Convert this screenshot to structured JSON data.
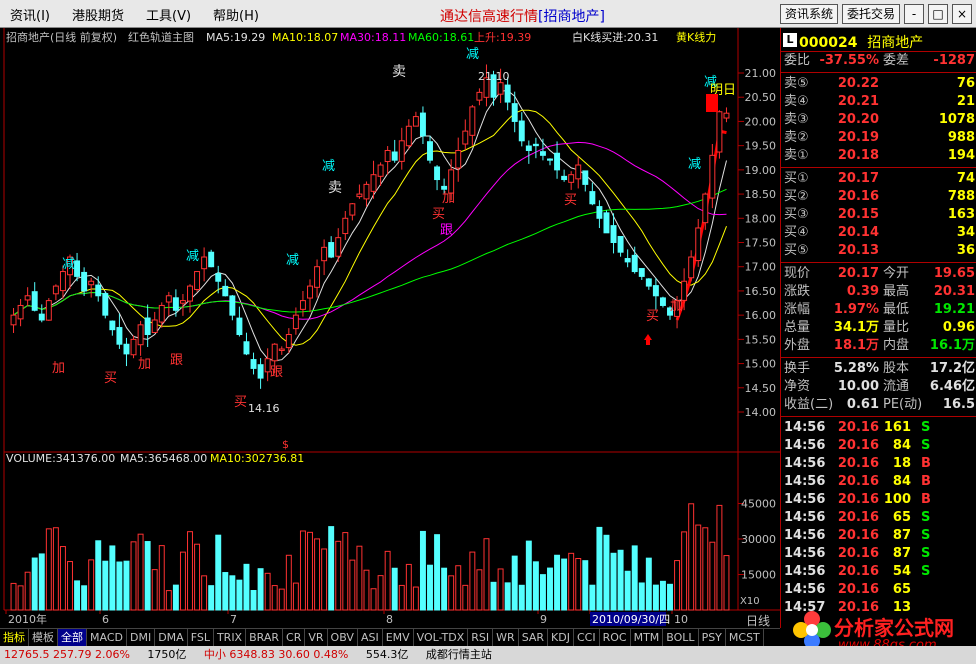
{
  "menu": [
    "资讯(I)",
    "港股期货",
    "工具(V)",
    "帮助(H)"
  ],
  "app_title": "通达信高速行情",
  "app_stock": "[招商地产]",
  "top_buttons": [
    "资讯系统",
    "委托交易"
  ],
  "window_buttons": [
    "-",
    "□",
    "×"
  ],
  "chart_header": {
    "name": "招商地产(日线 前复权)",
    "indicator": "红色轨道主图",
    "ma5": "MA5:19.29",
    "ma10": "MA10:18.07",
    "ma30": "MA30:18.11",
    "ma60": "MA60:18.61",
    "trend": "上升:19.39",
    "bline": "白K线买进:20.31",
    "yline": "黄K线力"
  },
  "volume_header": {
    "vol": "VOLUME:341376.00",
    "ma5": "MA5:365468.00",
    "ma10": "MA10:302736.81"
  },
  "annotations": {
    "sell1": "卖",
    "sell2": "卖",
    "sell3": "卖",
    "reduce": "减",
    "buy": "买",
    "add": "加",
    "follow": "跟",
    "tomorrow": "明日",
    "low_label": "14.16",
    "high_label": "21.10"
  },
  "chart_data": {
    "type": "candlestick",
    "price_axis": [
      21.0,
      20.5,
      20.0,
      19.5,
      19.0,
      18.5,
      18.0,
      17.5,
      17.0,
      16.5,
      16.0,
      15.5,
      15.0,
      14.5,
      14.0
    ],
    "volume_axis": [
      45000,
      30000,
      15000
    ],
    "volume_unit": "X10",
    "x_labels": [
      "2010年",
      "6",
      "7",
      "8",
      "9",
      "2010/09/30/四",
      "10"
    ],
    "closes": [
      16.0,
      16.2,
      16.4,
      16.1,
      15.9,
      16.3,
      16.6,
      16.9,
      17.2,
      16.8,
      16.5,
      16.7,
      16.4,
      16.0,
      15.7,
      15.4,
      15.2,
      15.5,
      15.8,
      15.6,
      15.9,
      16.2,
      16.4,
      16.1,
      16.3,
      16.6,
      16.9,
      17.2,
      17.0,
      16.7,
      16.4,
      16.0,
      15.6,
      15.2,
      14.9,
      14.7,
      15.1,
      15.4,
      15.3,
      15.6,
      16.0,
      16.3,
      16.6,
      17.0,
      17.4,
      17.2,
      17.6,
      18.0,
      18.3,
      18.5,
      18.7,
      18.9,
      19.1,
      19.4,
      19.2,
      19.6,
      19.9,
      20.1,
      19.7,
      19.2,
      18.8,
      18.6,
      19.0,
      19.4,
      19.8,
      20.3,
      20.6,
      20.9,
      20.5,
      20.8,
      20.4,
      20.0,
      19.6,
      19.4,
      19.5,
      19.3,
      19.2,
      19.0,
      18.8,
      18.9,
      19.1,
      18.7,
      18.3,
      18.0,
      17.7,
      17.5,
      17.3,
      17.1,
      16.9,
      16.8,
      16.6,
      16.4,
      16.2,
      16.0,
      16.3,
      16.7,
      17.2,
      17.8,
      18.5,
      19.3,
      20.2,
      20.17
    ],
    "last_price": 20.17
  },
  "quote": {
    "code": "000024",
    "name": "招商地产",
    "lbox": "L",
    "ratio_label": "委比",
    "ratio": "-37.55%",
    "diff_label": "委差",
    "diff": "-1287",
    "sells": [
      {
        "label": "卖⑤",
        "price": "20.22",
        "vol": "76"
      },
      {
        "label": "卖④",
        "price": "20.21",
        "vol": "21"
      },
      {
        "label": "卖③",
        "price": "20.20",
        "vol": "1078"
      },
      {
        "label": "卖②",
        "price": "20.19",
        "vol": "988"
      },
      {
        "label": "卖①",
        "price": "20.18",
        "vol": "194"
      }
    ],
    "buys": [
      {
        "label": "买①",
        "price": "20.17",
        "vol": "74"
      },
      {
        "label": "买②",
        "price": "20.16",
        "vol": "788"
      },
      {
        "label": "买③",
        "price": "20.15",
        "vol": "163"
      },
      {
        "label": "买④",
        "price": "20.14",
        "vol": "34"
      },
      {
        "label": "买⑤",
        "price": "20.13",
        "vol": "36"
      }
    ],
    "stats": [
      {
        "l1": "现价",
        "v1": "20.17",
        "c1": "red",
        "l2": "今开",
        "v2": "19.65",
        "c2": "red"
      },
      {
        "l1": "涨跌",
        "v1": "0.39",
        "c1": "red",
        "l2": "最高",
        "v2": "20.31",
        "c2": "red"
      },
      {
        "l1": "涨幅",
        "v1": "1.97%",
        "c1": "red",
        "l2": "最低",
        "v2": "19.21",
        "c2": "green"
      },
      {
        "l1": "总量",
        "v1": "34.1万",
        "c1": "yel",
        "l2": "量比",
        "v2": "0.96",
        "c2": "yel"
      },
      {
        "l1": "外盘",
        "v1": "18.1万",
        "c1": "red",
        "l2": "内盘",
        "v2": "16.1万",
        "c2": "green"
      }
    ],
    "stats2": [
      {
        "l1": "换手",
        "v1": "5.28%",
        "c1": "wht",
        "l2": "股本",
        "v2": "17.2亿",
        "c2": "wht"
      },
      {
        "l1": "净资",
        "v1": "10.00",
        "c1": "wht",
        "l2": "流通",
        "v2": "6.46亿",
        "c2": "wht"
      },
      {
        "l1": "收益(二)",
        "v1": "0.61",
        "c1": "wht",
        "l2": "PE(动)",
        "v2": "16.5",
        "c2": "wht"
      }
    ],
    "ticks": [
      {
        "t": "14:56",
        "p": "20.16",
        "v": "161",
        "bs": "S"
      },
      {
        "t": "14:56",
        "p": "20.16",
        "v": "84",
        "bs": "S"
      },
      {
        "t": "14:56",
        "p": "20.16",
        "v": "18",
        "bs": "B"
      },
      {
        "t": "14:56",
        "p": "20.16",
        "v": "84",
        "bs": "B"
      },
      {
        "t": "14:56",
        "p": "20.16",
        "v": "100",
        "bs": "B"
      },
      {
        "t": "14:56",
        "p": "20.16",
        "v": "65",
        "bs": "S"
      },
      {
        "t": "14:56",
        "p": "20.16",
        "v": "87",
        "bs": "S"
      },
      {
        "t": "14:56",
        "p": "20.16",
        "v": "87",
        "bs": "S"
      },
      {
        "t": "14:56",
        "p": "20.16",
        "v": "54",
        "bs": "S"
      },
      {
        "t": "14:56",
        "p": "20.16",
        "v": "65",
        "bs": ""
      },
      {
        "t": "14:57",
        "p": "20.16",
        "v": "13",
        "bs": ""
      }
    ]
  },
  "tabs": [
    "指标",
    "模板",
    "全部",
    "MACD",
    "DMI",
    "DMA",
    "FSL",
    "TRIX",
    "BRAR",
    "CR",
    "VR",
    "OBV",
    "ASI",
    "EMV",
    "VOL-TDX",
    "RSI",
    "WR",
    "SAR",
    "KDJ",
    "CCI",
    "ROC",
    "MTM",
    "BOLL",
    "PSY",
    "MCST"
  ],
  "right_tab": "日线",
  "statusbar": {
    "a": "12765.5  257.79  2.06%",
    "b": "1750亿",
    "c": "中小 6348.83  30.60  0.48%",
    "d": "554.3亿",
    "e": "成都行情主站"
  },
  "logo": {
    "text": "分析家公式网",
    "url": "www.88gs.com"
  }
}
